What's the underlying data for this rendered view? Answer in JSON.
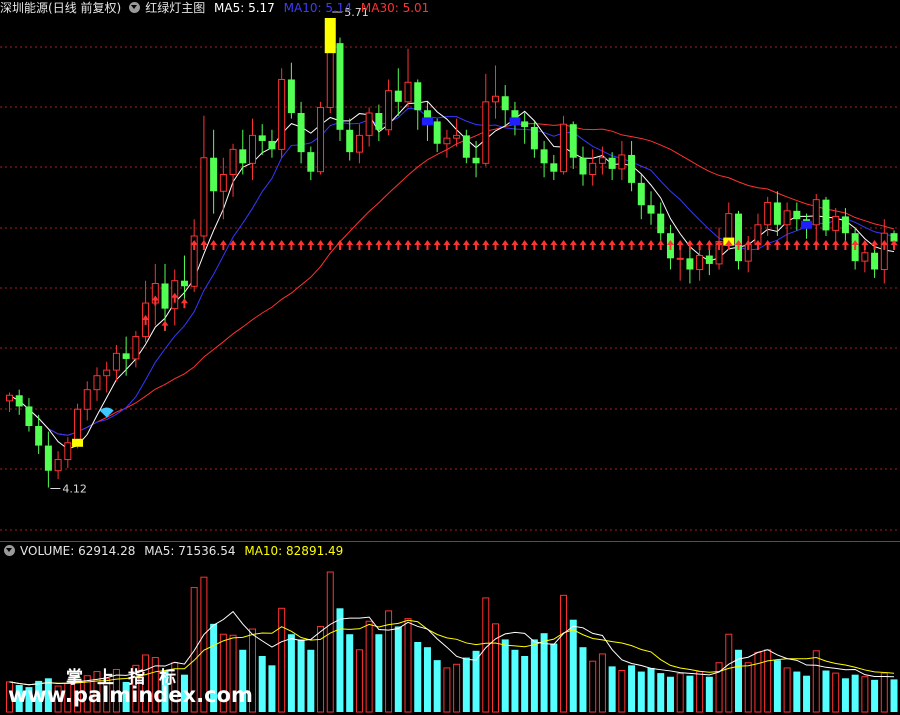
{
  "colors": {
    "up": "#ff3232",
    "down": "#54ff54",
    "ma5": "#ffffff",
    "ma10": "#3737ff",
    "ma30": "#ff3232",
    "vol_down": "#54ffff",
    "vol_ma5": "#ffffff",
    "vol_ma10": "#ffff00",
    "grid": "#a02020",
    "signal_yellow": "#ffff00",
    "signal_blue": "#1f1fff"
  },
  "header": {
    "security_name": "深圳能源",
    "period_label": "(日线 前复权)",
    "indicator_name": "红绿灯主图",
    "ma5": "MA5: 5.17",
    "ma10": "MA10: 5.14",
    "ma30": "MA30: 5.01"
  },
  "volume_header": {
    "label": "VOLUME: 62914.28",
    "ma5": "MA5: 71536.54",
    "ma10": "MA10: 82891.49"
  },
  "watermark": {
    "line1": "掌上指标",
    "line2": "www.palmindex.com"
  },
  "chart_data": {
    "type": "candlestick",
    "price_range": [
      3.95,
      5.8
    ],
    "annotations": [
      {
        "text": "5.71",
        "type": "high_marker"
      },
      {
        "text": "4.12",
        "type": "low_marker"
      }
    ],
    "buy_arrows": {
      "first_index": 14,
      "last_index": 19,
      "level": "close",
      "continuous_from_index": 19
    },
    "bars": [
      [
        4.43,
        4.46,
        4.39,
        4.45,
        58000
      ],
      [
        4.45,
        4.47,
        4.38,
        4.41,
        52000
      ],
      [
        4.41,
        4.44,
        4.32,
        4.34,
        48000
      ],
      [
        4.34,
        4.38,
        4.24,
        4.27,
        60000
      ],
      [
        4.27,
        4.32,
        4.12,
        4.18,
        65000
      ],
      [
        4.18,
        4.25,
        4.15,
        4.22,
        50000
      ],
      [
        4.22,
        4.3,
        4.19,
        4.28,
        55000
      ],
      [
        4.28,
        4.42,
        4.26,
        4.4,
        62000
      ],
      [
        4.4,
        4.5,
        4.36,
        4.47,
        70000
      ],
      [
        4.47,
        4.55,
        4.43,
        4.52,
        78000
      ],
      [
        4.52,
        4.57,
        4.46,
        4.54,
        65000
      ],
      [
        4.54,
        4.63,
        4.5,
        4.6,
        82000
      ],
      [
        4.6,
        4.66,
        4.52,
        4.58,
        58000
      ],
      [
        4.58,
        4.68,
        4.55,
        4.66,
        90000
      ],
      [
        4.66,
        4.86,
        4.64,
        4.78,
        110000
      ],
      [
        4.78,
        4.92,
        4.7,
        4.85,
        105000
      ],
      [
        4.85,
        4.92,
        4.68,
        4.76,
        80000
      ],
      [
        4.76,
        4.9,
        4.7,
        4.86,
        95000
      ],
      [
        4.86,
        4.95,
        4.79,
        4.84,
        72000
      ],
      [
        4.84,
        5.08,
        4.82,
        5.02,
        240000
      ],
      [
        5.02,
        5.45,
        4.98,
        5.3,
        260000
      ],
      [
        5.3,
        5.4,
        5.1,
        5.18,
        170000
      ],
      [
        5.18,
        5.3,
        5.08,
        5.24,
        150000
      ],
      [
        5.24,
        5.35,
        5.16,
        5.33,
        148000
      ],
      [
        5.33,
        5.4,
        5.24,
        5.28,
        120000
      ],
      [
        5.28,
        5.44,
        5.22,
        5.38,
        160000
      ],
      [
        5.38,
        5.42,
        5.31,
        5.36,
        108000
      ],
      [
        5.36,
        5.4,
        5.3,
        5.33,
        90000
      ],
      [
        5.33,
        5.62,
        5.3,
        5.58,
        200000
      ],
      [
        5.58,
        5.64,
        5.44,
        5.46,
        150000
      ],
      [
        5.46,
        5.5,
        5.28,
        5.32,
        140000
      ],
      [
        5.32,
        5.34,
        5.22,
        5.25,
        120000
      ],
      [
        5.25,
        5.5,
        5.24,
        5.48,
        165000
      ],
      [
        5.48,
        5.8,
        5.46,
        5.71,
        270000
      ],
      [
        5.71,
        5.73,
        5.36,
        5.4,
        200000
      ],
      [
        5.4,
        5.44,
        5.29,
        5.32,
        150000
      ],
      [
        5.32,
        5.42,
        5.28,
        5.38,
        120000
      ],
      [
        5.38,
        5.48,
        5.34,
        5.46,
        175000
      ],
      [
        5.46,
        5.49,
        5.36,
        5.4,
        150000
      ],
      [
        5.4,
        5.58,
        5.38,
        5.54,
        195000
      ],
      [
        5.54,
        5.62,
        5.45,
        5.5,
        165000
      ],
      [
        5.5,
        5.69,
        5.48,
        5.57,
        180000
      ],
      [
        5.57,
        5.58,
        5.4,
        5.47,
        135000
      ],
      [
        5.47,
        5.5,
        5.36,
        5.43,
        125000
      ],
      [
        5.43,
        5.44,
        5.32,
        5.35,
        100000
      ],
      [
        5.35,
        5.4,
        5.3,
        5.37,
        85000
      ],
      [
        5.37,
        5.44,
        5.34,
        5.38,
        92000
      ],
      [
        5.38,
        5.4,
        5.28,
        5.3,
        105000
      ],
      [
        5.3,
        5.36,
        5.23,
        5.28,
        118000
      ],
      [
        5.28,
        5.6,
        5.27,
        5.5,
        220000
      ],
      [
        5.5,
        5.63,
        5.44,
        5.52,
        170000
      ],
      [
        5.52,
        5.56,
        5.41,
        5.47,
        140000
      ],
      [
        5.47,
        5.5,
        5.38,
        5.43,
        120000
      ],
      [
        5.43,
        5.46,
        5.35,
        5.41,
        108000
      ],
      [
        5.41,
        5.43,
        5.3,
        5.33,
        140000
      ],
      [
        5.33,
        5.36,
        5.23,
        5.28,
        152000
      ],
      [
        5.28,
        5.31,
        5.22,
        5.25,
        132000
      ],
      [
        5.25,
        5.45,
        5.24,
        5.42,
        225000
      ],
      [
        5.42,
        5.43,
        5.26,
        5.3,
        178000
      ],
      [
        5.3,
        5.34,
        5.2,
        5.24,
        125000
      ],
      [
        5.24,
        5.33,
        5.2,
        5.28,
        98000
      ],
      [
        5.28,
        5.34,
        5.24,
        5.3,
        112000
      ],
      [
        5.3,
        5.32,
        5.22,
        5.26,
        88000
      ],
      [
        5.26,
        5.36,
        5.22,
        5.31,
        80000
      ],
      [
        5.31,
        5.36,
        5.18,
        5.21,
        90000
      ],
      [
        5.21,
        5.24,
        5.08,
        5.13,
        78000
      ],
      [
        5.13,
        5.18,
        5.06,
        5.1,
        85000
      ],
      [
        5.1,
        5.14,
        4.98,
        5.03,
        75000
      ],
      [
        5.03,
        5.06,
        4.9,
        4.94,
        68000
      ],
      [
        4.94,
        4.99,
        4.86,
        4.94,
        74000
      ],
      [
        4.94,
        4.97,
        4.85,
        4.9,
        70000
      ],
      [
        4.9,
        4.97,
        4.86,
        4.95,
        78000
      ],
      [
        4.95,
        4.99,
        4.88,
        4.92,
        68000
      ],
      [
        4.92,
        5.05,
        4.9,
        5.0,
        95000
      ],
      [
        5.0,
        5.14,
        4.98,
        5.1,
        150000
      ],
      [
        5.1,
        5.11,
        4.9,
        4.93,
        120000
      ],
      [
        4.93,
        5.02,
        4.89,
        4.99,
        95000
      ],
      [
        4.99,
        5.1,
        4.97,
        5.06,
        115000
      ],
      [
        5.06,
        5.16,
        5.02,
        5.14,
        120000
      ],
      [
        5.14,
        5.18,
        5.02,
        5.06,
        100000
      ],
      [
        5.06,
        5.14,
        5.0,
        5.11,
        85000
      ],
      [
        5.11,
        5.14,
        5.04,
        5.08,
        78000
      ],
      [
        5.08,
        5.1,
        5.01,
        5.06,
        70000
      ],
      [
        5.06,
        5.17,
        5.0,
        5.15,
        118000
      ],
      [
        5.15,
        5.16,
        5.02,
        5.04,
        80000
      ],
      [
        5.04,
        5.12,
        5.0,
        5.09,
        75000
      ],
      [
        5.09,
        5.12,
        5.0,
        5.03,
        65000
      ],
      [
        5.03,
        5.05,
        4.9,
        4.93,
        72000
      ],
      [
        4.93,
        4.98,
        4.89,
        4.96,
        68000
      ],
      [
        4.96,
        5.0,
        4.87,
        4.9,
        62000
      ],
      [
        4.9,
        5.08,
        4.85,
        5.03,
        75000
      ],
      [
        5.03,
        5.04,
        4.98,
        5.0,
        62914
      ]
    ]
  }
}
